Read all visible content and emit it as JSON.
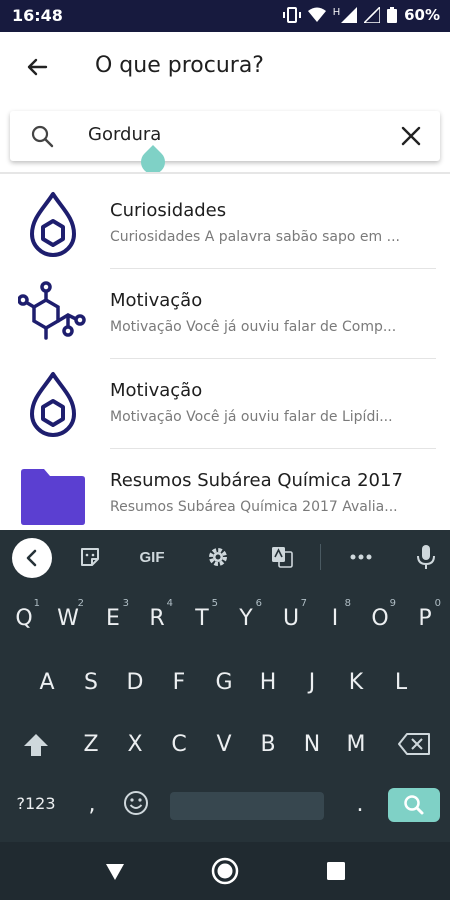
{
  "status_bar": {
    "time": "16:48",
    "network_label": "H",
    "battery_percent": "60%"
  },
  "header": {
    "title": "O que procura?"
  },
  "search": {
    "value": "Gordura"
  },
  "results": [
    {
      "title": "Curiosidades",
      "subtitle": "Curiosidades A palavra sabão sapo em ...",
      "icon": "drop-hexagon-icon"
    },
    {
      "title": "Motivação",
      "subtitle": "Motivação Você já ouviu falar de Comp...",
      "icon": "molecule-icon"
    },
    {
      "title": "Motivação",
      "subtitle": "Motivação Você já ouviu falar de Lipídi...",
      "icon": "drop-hexagon-icon"
    },
    {
      "title": "Resumos Subárea Química 2017",
      "subtitle": "Resumos Subárea Química 2017 Avalia...",
      "icon": "folder-icon"
    }
  ],
  "keyboard": {
    "toolbar": {
      "gif": "GIF"
    },
    "row1": [
      {
        "key": "Q",
        "num": "1"
      },
      {
        "key": "W",
        "num": "2"
      },
      {
        "key": "E",
        "num": "3"
      },
      {
        "key": "R",
        "num": "4"
      },
      {
        "key": "T",
        "num": "5"
      },
      {
        "key": "Y",
        "num": "6"
      },
      {
        "key": "U",
        "num": "7"
      },
      {
        "key": "I",
        "num": "8"
      },
      {
        "key": "O",
        "num": "9"
      },
      {
        "key": "P",
        "num": "0"
      }
    ],
    "row2": [
      "A",
      "S",
      "D",
      "F",
      "G",
      "H",
      "J",
      "K",
      "L"
    ],
    "row3": [
      "Z",
      "X",
      "C",
      "V",
      "B",
      "N",
      "M"
    ],
    "row4": {
      "symbols": "?123",
      "comma": ",",
      "period": "."
    }
  },
  "colors": {
    "status_bar": "#171a3e",
    "icon_navy": "#1e1e6e",
    "folder_purple": "#5b3fd1",
    "accent_teal": "#7fd1c6",
    "keyboard_bg": "#263238"
  }
}
